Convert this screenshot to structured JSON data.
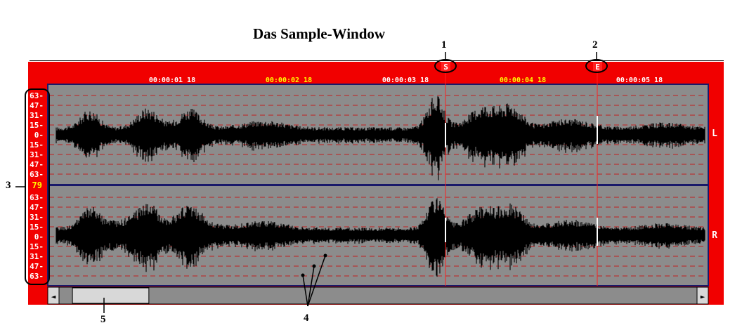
{
  "title": "Das Sample-Window",
  "colors": {
    "frame": "#f10000",
    "wave_bg": "#8c8c8c",
    "waveform": "#000000",
    "grid_line": "#c02020",
    "timecode": "#ffffff",
    "timecode_highlight": "#ffff00",
    "marker_line": "#ff2020",
    "marker_white": "#ffffff"
  },
  "timecodes": [
    {
      "label": "00:00:01 18",
      "highlight": false
    },
    {
      "label": "00:00:02 18",
      "highlight": true
    },
    {
      "label": "00:00:03 18",
      "highlight": false
    },
    {
      "label": "00:00:04 18",
      "highlight": true
    },
    {
      "label": "00:00:05 18",
      "highlight": false
    }
  ],
  "markers": {
    "start": {
      "label": "S",
      "callout": "1"
    },
    "end": {
      "label": "E",
      "callout": "2"
    }
  },
  "level_scale": {
    "upper": [
      "63",
      "47",
      "31",
      "15",
      "0",
      "15",
      "31",
      "47",
      "63"
    ],
    "center": "79",
    "lower": [
      "63",
      "47",
      "31",
      "15",
      "0",
      "15",
      "31",
      "47",
      "63"
    ]
  },
  "channels": {
    "left": "L",
    "right": "R"
  },
  "callouts": {
    "scale": "3",
    "grid": "4",
    "scrollbar": "5"
  },
  "scrollbar": {
    "left_arrow": "◄",
    "right_arrow": "►",
    "thumb_position": 0.02,
    "thumb_fraction": 0.12
  }
}
